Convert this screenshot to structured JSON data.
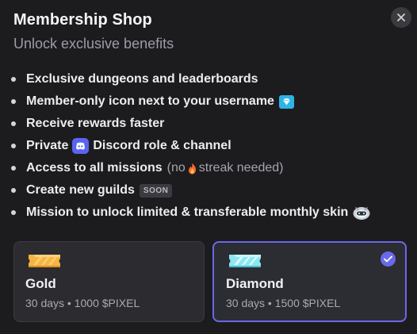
{
  "header": {
    "title": "Membership Shop",
    "subtitle": "Unlock exclusive benefits"
  },
  "benefits": [
    {
      "text": "Exclusive dungeons and leaderboards"
    },
    {
      "text": "Member-only icon next to your username",
      "icon": "diamond-badge-icon"
    },
    {
      "text": "Receive rewards faster"
    },
    {
      "before": "Private",
      "icon": "discord-icon",
      "after": "Discord role & channel"
    },
    {
      "text": "Access to all missions",
      "note_before": "(no",
      "note_icon": "fire-icon",
      "note_after": "streak needed)"
    },
    {
      "text": "Create new guilds",
      "badge": "SOON"
    },
    {
      "text": "Mission to unlock limited & transferable monthly skin",
      "icon": "skin-pet-icon"
    }
  ],
  "plans": [
    {
      "name": "Gold",
      "detail": "30 days • 1000 $PIXEL",
      "selected": false,
      "icon": "gold-ticket-icon",
      "color": "#f5b544"
    },
    {
      "name": "Diamond",
      "detail": "30 days • 1500 $PIXEL",
      "selected": true,
      "icon": "diamond-ticket-icon",
      "color": "#8ee7f0"
    }
  ],
  "colors": {
    "accent": "#6a69e8",
    "background": "#1c1c1f",
    "card": "#2b2b30",
    "discord": "#5865f2",
    "badge": "#2fb3e6"
  }
}
